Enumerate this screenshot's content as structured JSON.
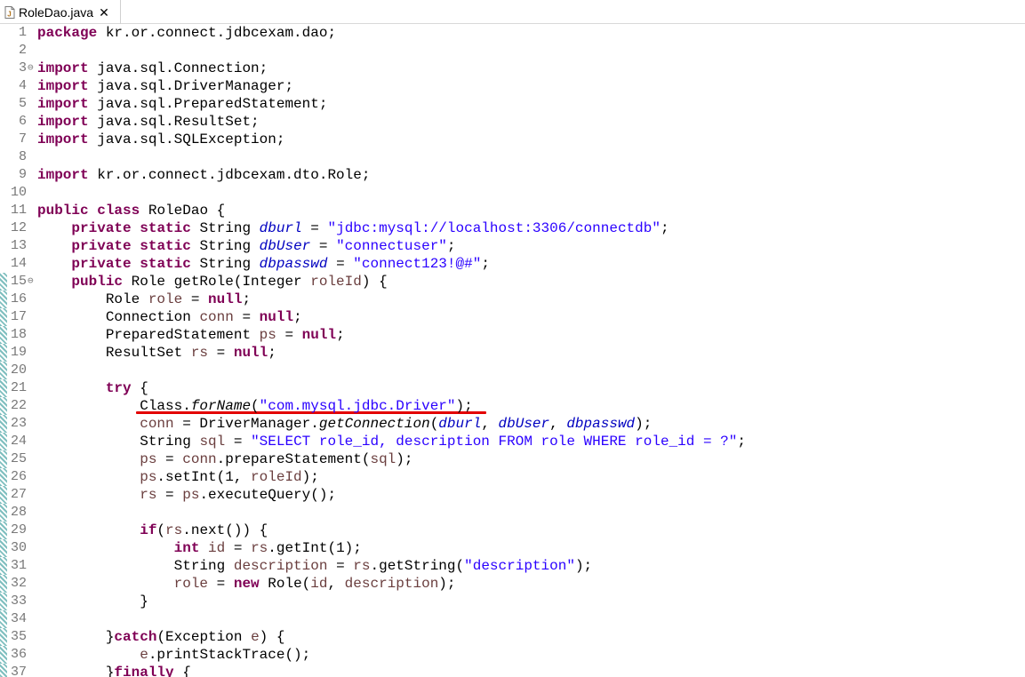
{
  "tab": {
    "title": "RoleDao.java",
    "close_glyph": "✕"
  },
  "accent": {
    "underline": "#e30000",
    "keyword": "#7f0055",
    "string": "#2a00ff",
    "field": "#0000c0"
  },
  "lines": [
    {
      "n": "1",
      "fold": "",
      "change": false,
      "tokens": [
        [
          "kw",
          "package"
        ],
        [
          "plain",
          " kr.or.connect.jdbcexam.dao;"
        ]
      ]
    },
    {
      "n": "2",
      "fold": "",
      "change": false,
      "tokens": []
    },
    {
      "n": "3",
      "fold": "⊖",
      "change": false,
      "tokens": [
        [
          "kw",
          "import"
        ],
        [
          "plain",
          " java.sql.Connection;"
        ]
      ]
    },
    {
      "n": "4",
      "fold": "",
      "change": false,
      "tokens": [
        [
          "kw",
          "import"
        ],
        [
          "plain",
          " java.sql.DriverManager;"
        ]
      ]
    },
    {
      "n": "5",
      "fold": "",
      "change": false,
      "tokens": [
        [
          "kw",
          "import"
        ],
        [
          "plain",
          " java.sql.PreparedStatement;"
        ]
      ]
    },
    {
      "n": "6",
      "fold": "",
      "change": false,
      "tokens": [
        [
          "kw",
          "import"
        ],
        [
          "plain",
          " java.sql.ResultSet;"
        ]
      ]
    },
    {
      "n": "7",
      "fold": "",
      "change": false,
      "tokens": [
        [
          "kw",
          "import"
        ],
        [
          "plain",
          " java.sql.SQLException;"
        ]
      ]
    },
    {
      "n": "8",
      "fold": "",
      "change": false,
      "tokens": []
    },
    {
      "n": "9",
      "fold": "",
      "change": false,
      "tokens": [
        [
          "kw",
          "import"
        ],
        [
          "plain",
          " kr.or.connect.jdbcexam.dto.Role;"
        ]
      ]
    },
    {
      "n": "10",
      "fold": "",
      "change": false,
      "tokens": []
    },
    {
      "n": "11",
      "fold": "",
      "change": false,
      "tokens": [
        [
          "kw",
          "public"
        ],
        [
          "plain",
          " "
        ],
        [
          "kw",
          "class"
        ],
        [
          "plain",
          " RoleDao {"
        ]
      ]
    },
    {
      "n": "12",
      "fold": "",
      "change": false,
      "tokens": [
        [
          "plain",
          "    "
        ],
        [
          "kw",
          "private"
        ],
        [
          "plain",
          " "
        ],
        [
          "kw",
          "static"
        ],
        [
          "plain",
          " String "
        ],
        [
          "fld",
          "dburl"
        ],
        [
          "plain",
          " = "
        ],
        [
          "str",
          "\"jdbc:mysql://localhost:3306/connectdb\""
        ],
        [
          "plain",
          ";"
        ]
      ]
    },
    {
      "n": "13",
      "fold": "",
      "change": false,
      "tokens": [
        [
          "plain",
          "    "
        ],
        [
          "kw",
          "private"
        ],
        [
          "plain",
          " "
        ],
        [
          "kw",
          "static"
        ],
        [
          "plain",
          " String "
        ],
        [
          "fld",
          "dbUser"
        ],
        [
          "plain",
          " = "
        ],
        [
          "str",
          "\"connectuser\""
        ],
        [
          "plain",
          ";"
        ]
      ]
    },
    {
      "n": "14",
      "fold": "",
      "change": false,
      "tokens": [
        [
          "plain",
          "    "
        ],
        [
          "kw",
          "private"
        ],
        [
          "plain",
          " "
        ],
        [
          "kw",
          "static"
        ],
        [
          "plain",
          " String "
        ],
        [
          "fld",
          "dbpasswd"
        ],
        [
          "plain",
          " = "
        ],
        [
          "str",
          "\"connect123!@#\""
        ],
        [
          "plain",
          ";"
        ]
      ]
    },
    {
      "n": "15",
      "fold": "⊖",
      "change": true,
      "tokens": [
        [
          "plain",
          "    "
        ],
        [
          "kw",
          "public"
        ],
        [
          "plain",
          " Role getRole(Integer "
        ],
        [
          "var",
          "roleId"
        ],
        [
          "plain",
          ") {"
        ]
      ]
    },
    {
      "n": "16",
      "fold": "",
      "change": true,
      "tokens": [
        [
          "plain",
          "        Role "
        ],
        [
          "var",
          "role"
        ],
        [
          "plain",
          " = "
        ],
        [
          "kw",
          "null"
        ],
        [
          "plain",
          ";"
        ]
      ]
    },
    {
      "n": "17",
      "fold": "",
      "change": true,
      "tokens": [
        [
          "plain",
          "        Connection "
        ],
        [
          "var",
          "conn"
        ],
        [
          "plain",
          " = "
        ],
        [
          "kw",
          "null"
        ],
        [
          "plain",
          ";"
        ]
      ]
    },
    {
      "n": "18",
      "fold": "",
      "change": true,
      "tokens": [
        [
          "plain",
          "        PreparedStatement "
        ],
        [
          "var",
          "ps"
        ],
        [
          "plain",
          " = "
        ],
        [
          "kw",
          "null"
        ],
        [
          "plain",
          ";"
        ]
      ]
    },
    {
      "n": "19",
      "fold": "",
      "change": true,
      "tokens": [
        [
          "plain",
          "        ResultSet "
        ],
        [
          "var",
          "rs"
        ],
        [
          "plain",
          " = "
        ],
        [
          "kw",
          "null"
        ],
        [
          "plain",
          ";"
        ]
      ]
    },
    {
      "n": "20",
      "fold": "",
      "change": true,
      "tokens": []
    },
    {
      "n": "21",
      "fold": "",
      "change": true,
      "tokens": [
        [
          "plain",
          "        "
        ],
        [
          "kw",
          "try"
        ],
        [
          "plain",
          " {"
        ]
      ]
    },
    {
      "n": "22",
      "fold": "",
      "change": true,
      "tokens": [
        [
          "plain",
          "            Class."
        ],
        [
          "mth",
          "forName"
        ],
        [
          "plain",
          "("
        ],
        [
          "str",
          "\"com.mysql.jdbc.Driver\""
        ],
        [
          "plain",
          ");"
        ]
      ]
    },
    {
      "n": "23",
      "fold": "",
      "change": true,
      "tokens": [
        [
          "plain",
          "            "
        ],
        [
          "var",
          "conn"
        ],
        [
          "plain",
          " = DriverManager."
        ],
        [
          "mth",
          "getConnection"
        ],
        [
          "plain",
          "("
        ],
        [
          "fld",
          "dburl"
        ],
        [
          "plain",
          ", "
        ],
        [
          "fld",
          "dbUser"
        ],
        [
          "plain",
          ", "
        ],
        [
          "fld",
          "dbpasswd"
        ],
        [
          "plain",
          ");"
        ]
      ]
    },
    {
      "n": "24",
      "fold": "",
      "change": true,
      "tokens": [
        [
          "plain",
          "            String "
        ],
        [
          "var",
          "sql"
        ],
        [
          "plain",
          " = "
        ],
        [
          "str",
          "\"SELECT role_id, description FROM role WHERE role_id = ?\""
        ],
        [
          "plain",
          ";"
        ]
      ]
    },
    {
      "n": "25",
      "fold": "",
      "change": true,
      "tokens": [
        [
          "plain",
          "            "
        ],
        [
          "var",
          "ps"
        ],
        [
          "plain",
          " = "
        ],
        [
          "var",
          "conn"
        ],
        [
          "plain",
          ".prepareStatement("
        ],
        [
          "var",
          "sql"
        ],
        [
          "plain",
          ");"
        ]
      ]
    },
    {
      "n": "26",
      "fold": "",
      "change": true,
      "tokens": [
        [
          "plain",
          "            "
        ],
        [
          "var",
          "ps"
        ],
        [
          "plain",
          ".setInt(1, "
        ],
        [
          "var",
          "roleId"
        ],
        [
          "plain",
          ");"
        ]
      ]
    },
    {
      "n": "27",
      "fold": "",
      "change": true,
      "tokens": [
        [
          "plain",
          "            "
        ],
        [
          "var",
          "rs"
        ],
        [
          "plain",
          " = "
        ],
        [
          "var",
          "ps"
        ],
        [
          "plain",
          ".executeQuery();"
        ]
      ]
    },
    {
      "n": "28",
      "fold": "",
      "change": true,
      "tokens": []
    },
    {
      "n": "29",
      "fold": "",
      "change": true,
      "tokens": [
        [
          "plain",
          "            "
        ],
        [
          "kw",
          "if"
        ],
        [
          "plain",
          "("
        ],
        [
          "var",
          "rs"
        ],
        [
          "plain",
          ".next()) {"
        ]
      ]
    },
    {
      "n": "30",
      "fold": "",
      "change": true,
      "tokens": [
        [
          "plain",
          "                "
        ],
        [
          "kw",
          "int"
        ],
        [
          "plain",
          " "
        ],
        [
          "var",
          "id"
        ],
        [
          "plain",
          " = "
        ],
        [
          "var",
          "rs"
        ],
        [
          "plain",
          ".getInt(1);"
        ]
      ]
    },
    {
      "n": "31",
      "fold": "",
      "change": true,
      "tokens": [
        [
          "plain",
          "                String "
        ],
        [
          "var",
          "description"
        ],
        [
          "plain",
          " = "
        ],
        [
          "var",
          "rs"
        ],
        [
          "plain",
          ".getString("
        ],
        [
          "str",
          "\"description\""
        ],
        [
          "plain",
          ");"
        ]
      ]
    },
    {
      "n": "32",
      "fold": "",
      "change": true,
      "tokens": [
        [
          "plain",
          "                "
        ],
        [
          "var",
          "role"
        ],
        [
          "plain",
          " = "
        ],
        [
          "kw",
          "new"
        ],
        [
          "plain",
          " Role("
        ],
        [
          "var",
          "id"
        ],
        [
          "plain",
          ", "
        ],
        [
          "var",
          "description"
        ],
        [
          "plain",
          ");"
        ]
      ]
    },
    {
      "n": "33",
      "fold": "",
      "change": true,
      "tokens": [
        [
          "plain",
          "            }"
        ]
      ]
    },
    {
      "n": "34",
      "fold": "",
      "change": true,
      "tokens": []
    },
    {
      "n": "35",
      "fold": "",
      "change": true,
      "tokens": [
        [
          "plain",
          "        }"
        ],
        [
          "kw",
          "catch"
        ],
        [
          "plain",
          "(Exception "
        ],
        [
          "var",
          "e"
        ],
        [
          "plain",
          ") {"
        ]
      ]
    },
    {
      "n": "36",
      "fold": "",
      "change": true,
      "tokens": [
        [
          "plain",
          "            "
        ],
        [
          "var",
          "e"
        ],
        [
          "plain",
          ".printStackTrace();"
        ]
      ]
    },
    {
      "n": "37",
      "fold": "",
      "change": true,
      "tokens": [
        [
          "plain",
          "        }"
        ],
        [
          "kw",
          "finally"
        ],
        [
          "plain",
          " {"
        ]
      ]
    }
  ]
}
